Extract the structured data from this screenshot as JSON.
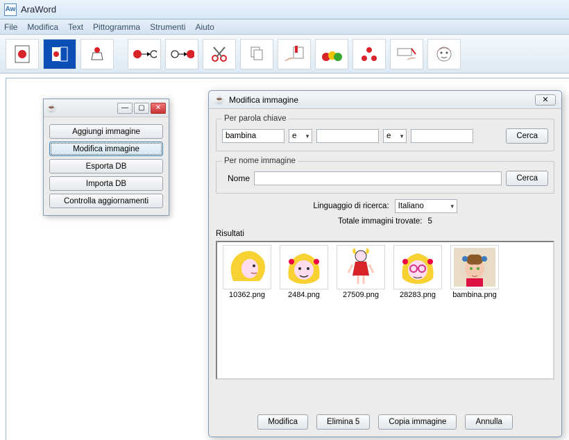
{
  "app": {
    "title": "AraWord"
  },
  "menu": [
    "File",
    "Modifica",
    "Text",
    "Pittogramma",
    "Strumenti",
    "Aiuto"
  ],
  "panel": {
    "buttons": [
      "Aggiungi immagine",
      "Modifica immagine",
      "Esporta DB",
      "Importa DB",
      "Controlla aggiornamenti"
    ],
    "selected": 1
  },
  "dialog": {
    "title": "Modifica immagine",
    "keyword": {
      "legend": "Per parola chiave",
      "field1": "bambina",
      "op1": "e",
      "field2": "",
      "op2": "e",
      "field3": "",
      "search": "Cerca"
    },
    "byname": {
      "legend": "Per nome immagine",
      "label": "Nome",
      "value": "",
      "search": "Cerca"
    },
    "langLabel": "Linguaggio di ricerca:",
    "langValue": "Italiano",
    "totalLabel": "Totale immagini trovate:",
    "totalValue": "5",
    "resultsLabel": "Risultati",
    "results": [
      "10362.png",
      "2484.png",
      "27509.png",
      "28283.png",
      "bambina.png"
    ],
    "actions": [
      "Modifica",
      "Elimina 5",
      "Copia immagine",
      "Annulla"
    ]
  }
}
